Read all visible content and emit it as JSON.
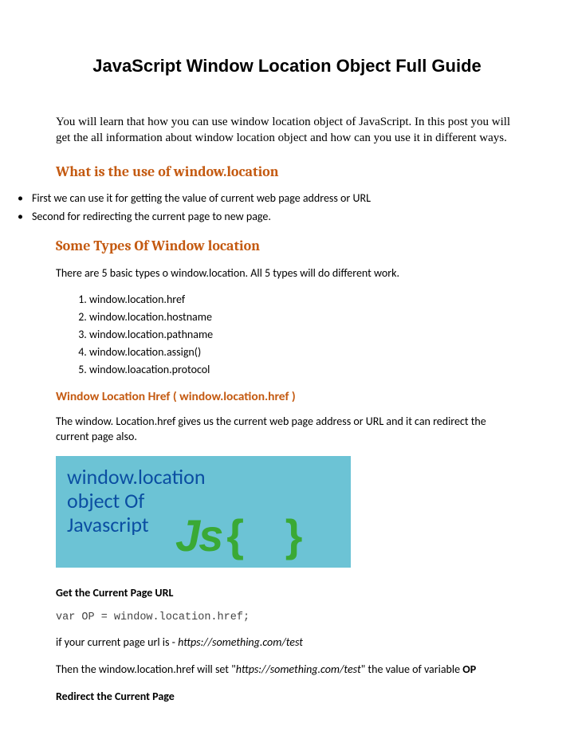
{
  "title": "JavaScript Window Location Object Full Guide",
  "intro": "You will learn that how you can use window location object of JavaScript. In this post you will get the all information about window location object and how can you use it in different ways.",
  "section1": {
    "heading": "What is the use of window.location",
    "bullets": [
      " First we can use it for getting the value of current web page address or URL",
      "Second for redirecting the current page to new page."
    ]
  },
  "section2": {
    "heading": "Some Types Of Window location",
    "intro": "There are 5 basic types o window.location. All 5 types will do different work.",
    "items": [
      "window.location.href",
      "window.location.hostname",
      "window.location.pathname",
      "window.location.assign()",
      "window.loacation.protocol"
    ]
  },
  "section3": {
    "heading": "Window Location Href ( window.location.href )",
    "desc": "The window. Location.href gives us the current web page address or URL and it can redirect the current page also."
  },
  "banner": {
    "line1": "window.location",
    "line2": "object Of",
    "line3": "Javascript",
    "js": "Js",
    "brace": "{ }"
  },
  "get_url": {
    "heading": "Get the Current Page URL",
    "code": "var OP = window.location.href;",
    "line1_pre": "if your current page url is - ",
    "line1_url": "https://something.com/test",
    "line2_pre": "Then the window.location.href will set \"",
    "line2_url": "https://something.com/test",
    "line2_post": "\"  the value of variable ",
    "line2_var": "OP"
  },
  "redirect": {
    "heading": "Redirect the Current Page"
  }
}
